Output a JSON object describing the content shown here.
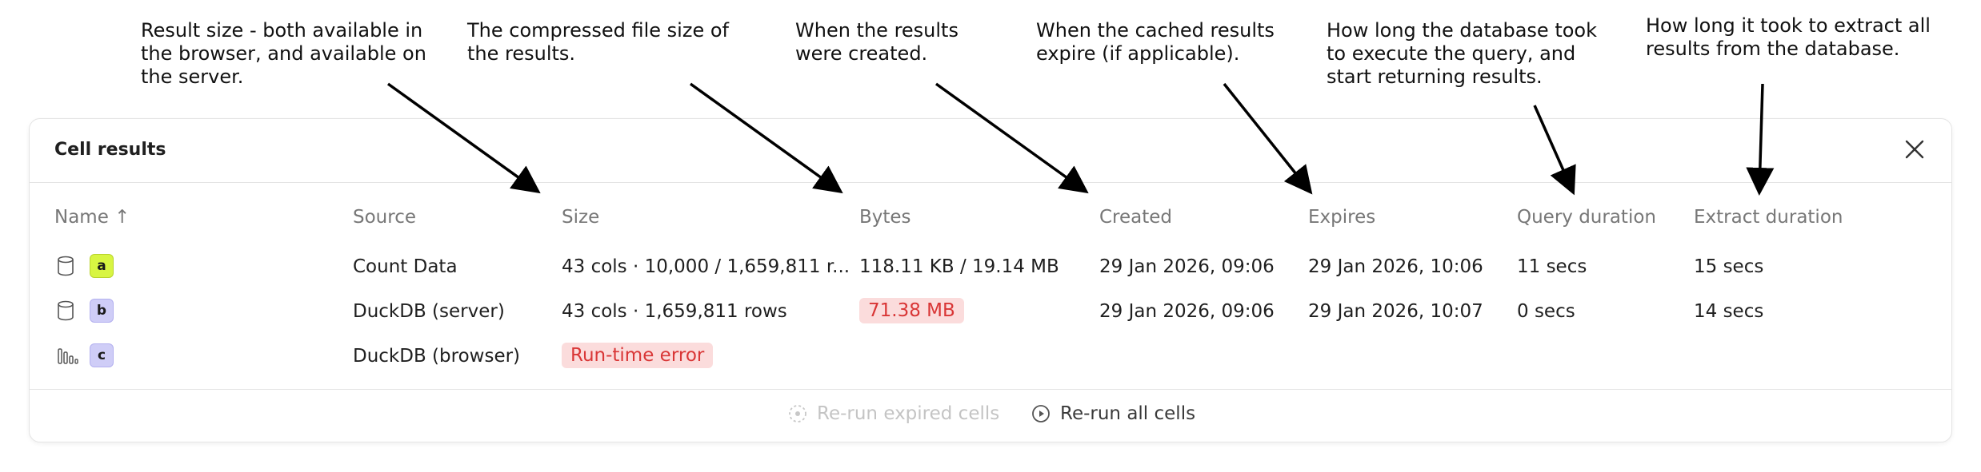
{
  "annotations": [
    "Result size - both available in\nthe browser, and available on\nthe server.",
    "The compressed file size of\nthe results.",
    "When the results\nwere created.",
    "When the cached results\nexpire (if applicable).",
    "How long the database took\nto execute the query, and\nstart returning results.",
    "How long it took to extract all\nresults from the database."
  ],
  "panel": {
    "title": "Cell results",
    "close_icon": "close-icon"
  },
  "columns": {
    "name": "Name ↑",
    "source": "Source",
    "size": "Size",
    "bytes": "Bytes",
    "created": "Created",
    "expires": "Expires",
    "query_duration": "Query duration",
    "extract_duration": "Extract duration"
  },
  "rows": [
    {
      "icon": "database-icon",
      "name": "a",
      "badge_color": "#d8f542",
      "badge_border": "#b9d42c",
      "source": "Count Data",
      "size": "43 cols · 10,000 / 1,659,811 r...",
      "bytes": "118.11 KB / 19.14 MB",
      "created": "29 Jan 2026, 09:06",
      "expires": "29 Jan 2026, 10:06",
      "query_duration": "11 secs",
      "extract_duration": "15 secs"
    },
    {
      "icon": "database-icon",
      "name": "b",
      "badge_color": "#cfcdf7",
      "badge_border": "#b3b0ef",
      "source": "DuckDB (server)",
      "size": "43 cols · 1,659,811 rows",
      "bytes": "71.38 MB",
      "created": "29 Jan 2026, 09:06",
      "expires": "29 Jan 2026, 10:07",
      "query_duration": "0 secs",
      "extract_duration": "14 secs"
    },
    {
      "icon": "bar-chart-icon",
      "name": "c",
      "badge_color": "#cfcdf7",
      "badge_border": "#b3b0ef",
      "source": "DuckDB (browser)",
      "size": "Run-time error"
    }
  ],
  "footer": {
    "rerun_expired": "Re-run expired cells",
    "rerun_all": "Re-run all cells"
  },
  "colors": {
    "error_bg": "#fbdcdc",
    "error_text": "#d93636",
    "header_text": "#777777",
    "border": "#e4e4e4"
  }
}
